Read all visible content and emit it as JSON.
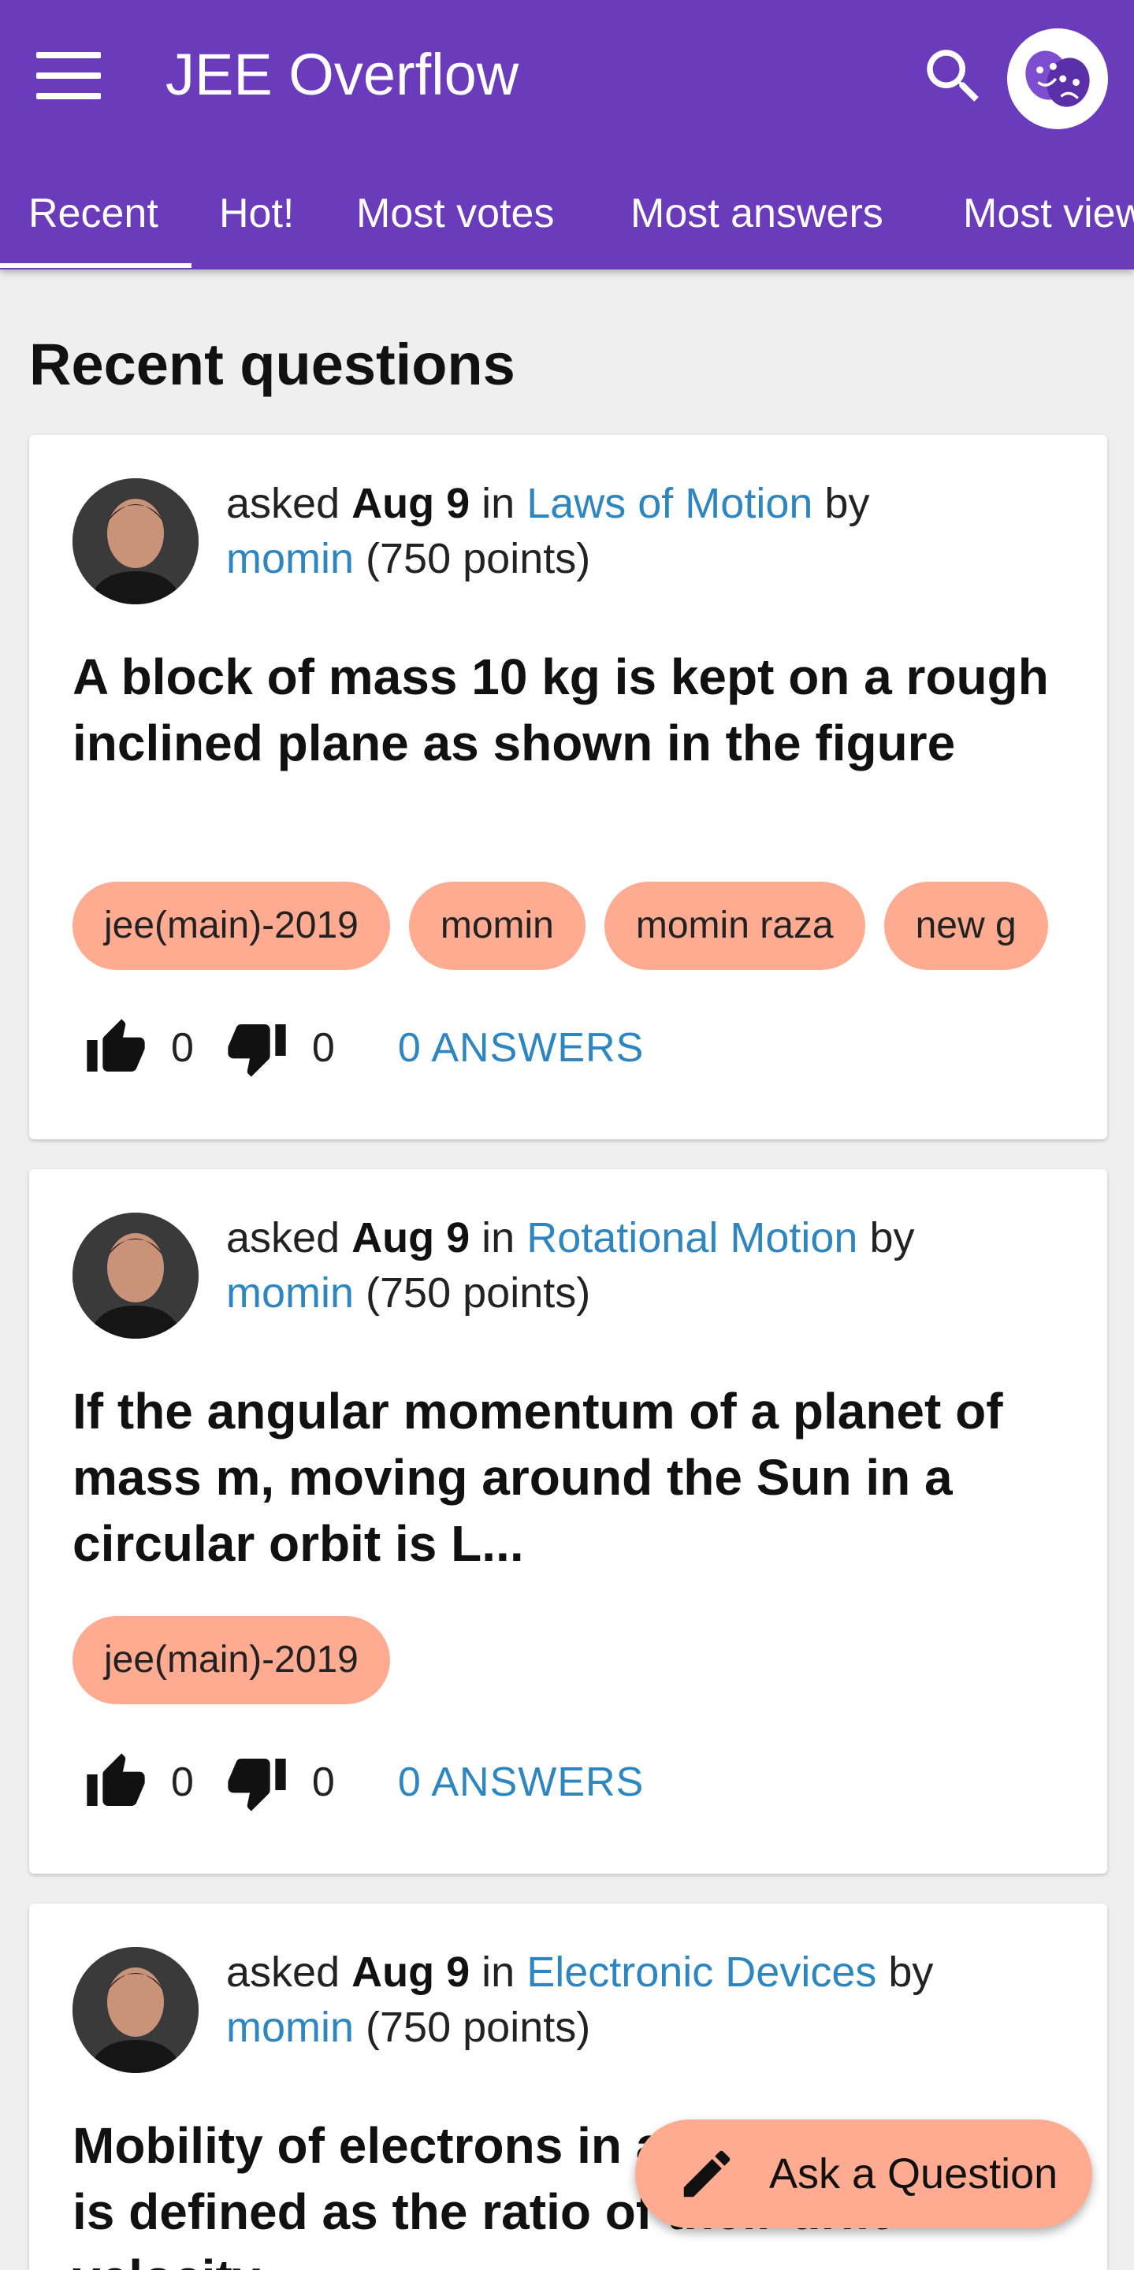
{
  "appbar": {
    "title": "JEE Overflow",
    "menu_icon": "hamburger-menu-icon",
    "search_icon": "search-icon",
    "avatar_icon": "theater-masks-icon"
  },
  "tabs": [
    {
      "label": "Recent"
    },
    {
      "label": "Hot!"
    },
    {
      "label": "Most votes"
    },
    {
      "label": "Most answers"
    },
    {
      "label": "Most views"
    }
  ],
  "section_title": "Recent questions",
  "questions": [
    {
      "asked": "asked",
      "when": "Aug 9",
      "in": "in",
      "category": "Laws of Motion",
      "by": "by",
      "user": "momin",
      "points": "(750 points)",
      "title": "A block of mass 10 kg is kept on a rough inclined plane as shown in the figure",
      "tags": [
        "jee(main)-2019",
        "momin",
        "momin raza",
        "new g"
      ],
      "upvotes": "0",
      "downvotes": "0",
      "answers": "0 ANSWERS"
    },
    {
      "asked": "asked",
      "when": "Aug 9",
      "in": "in",
      "category": "Rotational Motion",
      "by": "by",
      "user": "momin",
      "points": "(750 points)",
      "title": "If the angular momentum of a planet of mass m, moving around the Sun in a circular orbit is L...",
      "tags": [
        "jee(main)-2019"
      ],
      "upvotes": "0",
      "downvotes": "0",
      "answers": "0 ANSWERS"
    },
    {
      "asked": "asked",
      "when": "Aug 9",
      "in": "in",
      "category": "Electronic Devices",
      "by": "by",
      "user": "momin",
      "points": "(750 points)",
      "title": "Mobility of electrons in a semiconductor is defined as the ratio of their drift velocity"
    }
  ],
  "fab": {
    "label": "Ask a Question",
    "icon": "pencil-icon"
  },
  "colors": {
    "appbar": "#6a3bbb",
    "link": "#2e86c1",
    "tag": "#ffab91",
    "background": "#efefef"
  }
}
